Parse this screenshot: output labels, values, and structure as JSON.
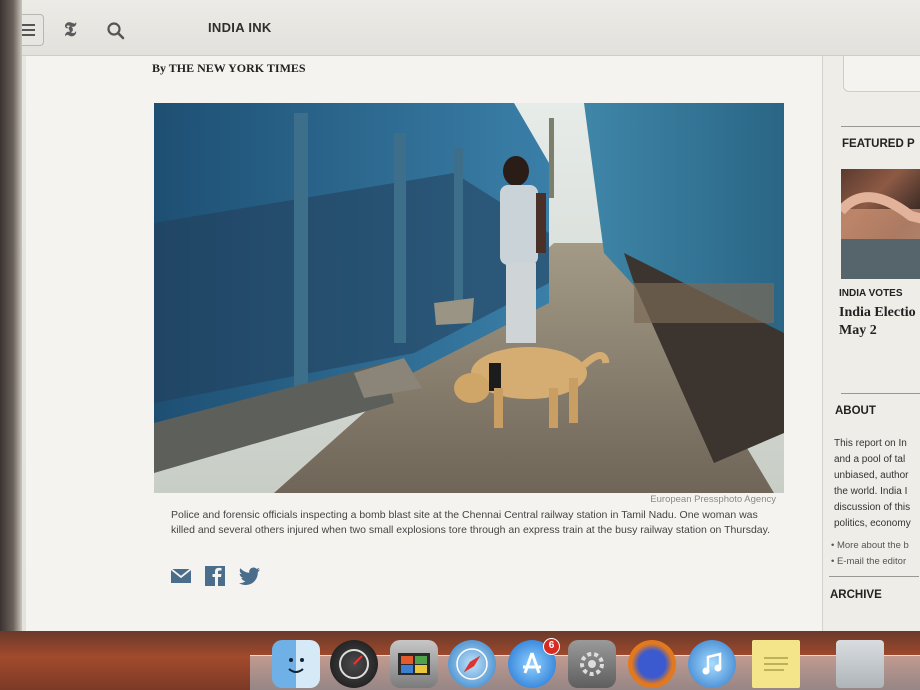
{
  "toolbar": {
    "section_title": "INDIA INK",
    "menu_icon": "hamburger-menu-icon",
    "logo_icon": "nyt-t-logo-icon",
    "search_icon": "search-icon"
  },
  "article": {
    "byline": "By THE NEW YORK TIMES",
    "photo_credit": "European Pressphoto Agency",
    "caption": "Police and forensic officials inspecting a bomb blast site at the Chennai Central railway station in Tamil Nadu. One woman was killed and several others injured when two small explosions tore through an express train at the busy railway station on Thursday.",
    "share_icons": [
      "email-icon",
      "facebook-icon",
      "twitter-icon"
    ]
  },
  "sidebar": {
    "featured_heading": "FEATURED P",
    "featured_kicker": "INDIA VOTES",
    "featured_headline_line1": "India Electio",
    "featured_headline_line2": "May 2",
    "about_heading": "ABOUT",
    "about_lines": [
      "This report on In",
      "and a pool of tal",
      "unbiased, author",
      "the world. India I",
      "discussion of this",
      "politics, economy"
    ],
    "links": [
      "• More about the b",
      "• E-mail the editor"
    ],
    "archive_heading": "ARCHIVE"
  },
  "dock": {
    "apps": [
      "finder-icon",
      "dashboard-icon",
      "photo-booth-icon",
      "safari-icon",
      "app-store-icon",
      "system-preferences-icon",
      "firefox-icon",
      "itunes-icon",
      "stickies-icon",
      "documents-icon"
    ],
    "app_store_badge": "6"
  },
  "colors": {
    "page_bg": "#f4f3ef",
    "toolbar_bg": "#e2e1dc",
    "train_blue": "#2f6f95",
    "dock_bg": "#a24a2c",
    "badge_red": "#d92a22"
  }
}
